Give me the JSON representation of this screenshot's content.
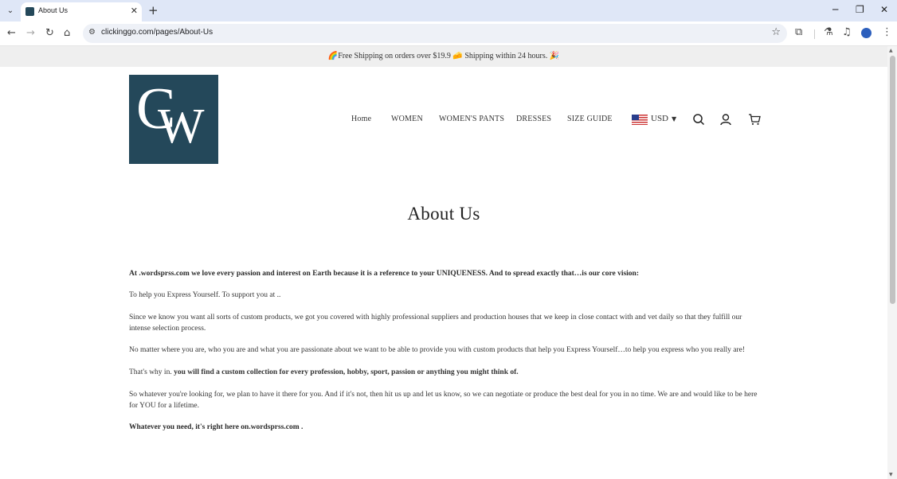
{
  "browser": {
    "tab_title": "About Us",
    "url": "clickinggo.com/pages/About-Us",
    "new_tab": "+",
    "tab_close": "✕",
    "window": {
      "minimize": "─",
      "restore": "❐",
      "close": "✕"
    }
  },
  "announcement": "🌈Free Shipping on orders over $19.9 🧀 Shipping within 24 hours. 🎉",
  "nav": {
    "items": [
      "Home",
      "WOMEN",
      "WOMEN'S PANTS",
      "DRESSES",
      "SIZE GUIDE"
    ],
    "currency": "USD"
  },
  "icons": {
    "search": "search-icon",
    "account": "account-icon",
    "cart": "cart-icon"
  },
  "logo": {
    "letters": [
      "C",
      "W"
    ]
  },
  "page_title": "About Us",
  "paragraphs": {
    "p1": "At .wordsprss.com we love every passion and interest on Earth because it is a reference to your UNIQUENESS. And to spread exactly that…is our core vision:",
    "p2": "To help you Express Yourself. To support you at ..",
    "p3": "Since we know you want all sorts of custom products, we got you covered with highly professional suppliers and production houses that we keep in close contact with and vet daily so that they fulfill our intense selection process.",
    "p4": "No matter where you are, who you are and what you are passionate about we want to be able to provide you with custom products that help you Express Yourself…to help you express who you really are!",
    "p5_a": "That's why in. ",
    "p5_b": "you will find a custom collection for every profession, hobby, sport, passion or anything you might think of.",
    "p6": "So whatever you're looking for, we plan to have it there for you. And if it's not, then hit us up and let us know, so we can negotiate or produce the best deal for you in no time. We are and would like to be here for YOU for a lifetime.",
    "p7": "Whatever you need, it's right here on.wordsprss.com ."
  }
}
